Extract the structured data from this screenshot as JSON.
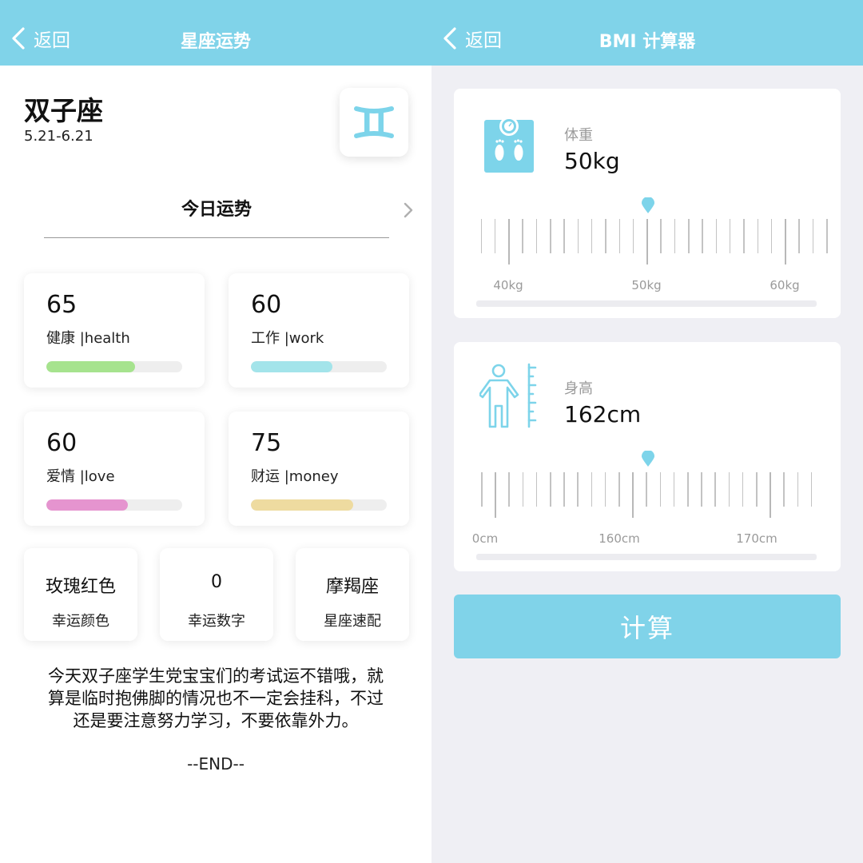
{
  "horoscope": {
    "nav": {
      "back_label": "返回",
      "title": "星座运势"
    },
    "sign_name": "双子座",
    "sign_dates": "5.21-6.21",
    "sign_icon": "gemini-icon",
    "tab_label": "今日运势",
    "scores": [
      {
        "value": "65",
        "label": "健康 |health",
        "percent": 65,
        "color": "#a6e38e"
      },
      {
        "value": "60",
        "label": "工作 |work",
        "percent": 60,
        "color": "#a3e4ea"
      },
      {
        "value": "60",
        "label": "爱情 |love",
        "percent": 60,
        "color": "#e594cf"
      },
      {
        "value": "75",
        "label": "财运 |money",
        "percent": 75,
        "color": "#eedba0"
      }
    ],
    "lucky": [
      {
        "value": "玫瑰红色",
        "label": "幸运颜色"
      },
      {
        "value": "0",
        "label": "幸运数字"
      },
      {
        "value": "摩羯座",
        "label": "星座速配"
      }
    ],
    "description_lines": [
      "今天双子座学生党宝宝们的考试运不错哦，就",
      "算是临时抱佛脚的情况也不一定会挂科，不过",
      "还是要注意努力学习，不要依靠外力。"
    ],
    "end_text": "--END--"
  },
  "bmi": {
    "nav": {
      "back_label": "返回",
      "title": "BMI 计算器"
    },
    "weight": {
      "icon": "scale-icon",
      "title": "体重",
      "value": "50kg",
      "labels": [
        "40kg",
        "50kg",
        "60kg"
      ]
    },
    "height": {
      "icon": "person-height-icon",
      "title": "身高",
      "value": "162cm",
      "labels": [
        "0cm",
        "160cm",
        "170cm"
      ]
    },
    "calc_label": "计算"
  },
  "colors": {
    "accent": "#80d3e9",
    "background_right": "#efeff4"
  }
}
